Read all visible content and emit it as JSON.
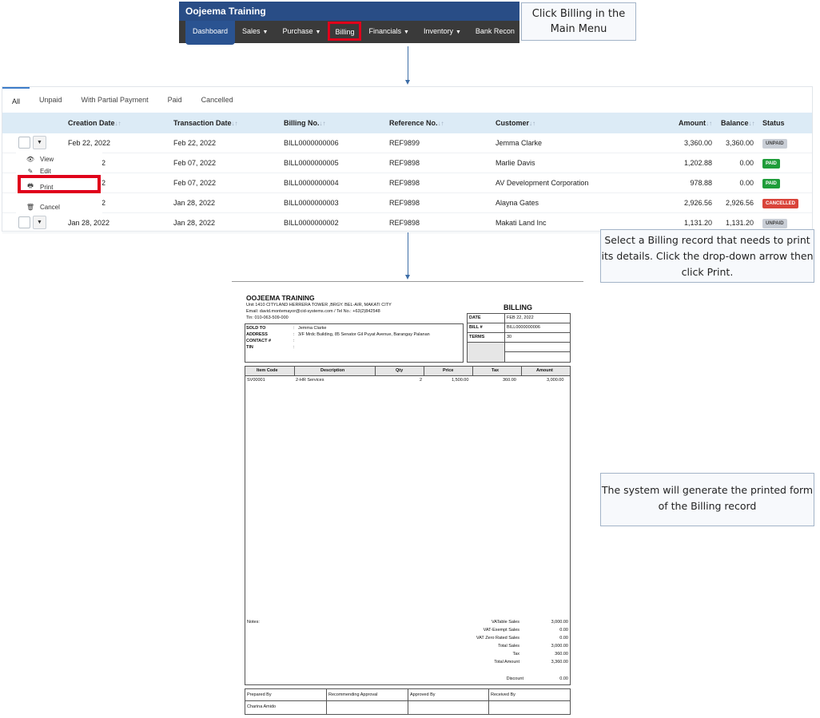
{
  "app": {
    "title": "Oojeema Training",
    "menu": [
      {
        "label": "Dashboard",
        "caret": false
      },
      {
        "label": "Sales",
        "caret": true
      },
      {
        "label": "Purchase",
        "caret": true
      },
      {
        "label": "Billing",
        "caret": false
      },
      {
        "label": "Financials",
        "caret": true
      },
      {
        "label": "Inventory",
        "caret": true
      },
      {
        "label": "Bank Recon",
        "caret": false
      }
    ]
  },
  "callouts": {
    "step1": "Click Billing in the Main Menu",
    "step2": "Select a Billing record that needs to print its details. Click the drop-down arrow then click Print.",
    "step3": "The system will generate the printed form of the Billing record"
  },
  "tabs": [
    "All",
    "Unpaid",
    "With Partial Payment",
    "Paid",
    "Cancelled"
  ],
  "table": {
    "headers": {
      "creation_date": "Creation Date",
      "transaction_date": "Transaction Date",
      "billing_no": "Billing No.",
      "reference_no": "Reference No.",
      "customer": "Customer",
      "amount": "Amount",
      "balance": "Balance",
      "status": "Status"
    },
    "rows": [
      {
        "creation": "Feb 22, 2022",
        "transaction": "Feb 22, 2022",
        "billing": "BILL0000000006",
        "reference": "REF9899",
        "customer": "Jemma Clarke",
        "amount": "3,360.00",
        "balance": "3,360.00",
        "status": "UNPAID",
        "status_color": "#c9ced6",
        "status_text": "#444444"
      },
      {
        "creation": "2",
        "transaction": "Feb 07, 2022",
        "billing": "BILL0000000005",
        "reference": "REF9898",
        "customer": "Marlie Davis",
        "amount": "1,202.88",
        "balance": "0.00",
        "status": "PAID",
        "status_color": "#1f9d3a",
        "status_text": "#ffffff"
      },
      {
        "creation": "2",
        "transaction": "Feb 07, 2022",
        "billing": "BILL0000000004",
        "reference": "REF9898",
        "customer": "AV Development Corporation",
        "amount": "978.88",
        "balance": "0.00",
        "status": "PAID",
        "status_color": "#1f9d3a",
        "status_text": "#ffffff"
      },
      {
        "creation": "2",
        "transaction": "Jan 28, 2022",
        "billing": "BILL0000000003",
        "reference": "REF9898",
        "customer": "Alayna Gates",
        "amount": "2,926.56",
        "balance": "2,926.56",
        "status": "CANCELLED",
        "status_color": "#d9443a",
        "status_text": "#ffffff"
      },
      {
        "creation": "Jan 28, 2022",
        "transaction": "Jan 28, 2022",
        "billing": "BILL0000000002",
        "reference": "REF9898",
        "customer": "Makati Land Inc",
        "amount": "1,131.20",
        "balance": "1,131.20",
        "status": "UNPAID",
        "status_color": "#c9ced6",
        "status_text": "#444444"
      }
    ]
  },
  "dropdown": {
    "view": "View",
    "edit": "Edit",
    "print": "Print",
    "cancel": "Cancel"
  },
  "form": {
    "company": "OOJEEMA TRAINING",
    "address": "Unit 1410 CITYLAND HERRERA TOWER ,BRGY. BEL-AIR, MAKATI CITY",
    "contact": "Email: david.montemayor@cid-systems.com / Tel No.: +63(2)842548",
    "tin": "Tin: 010-063-509-000",
    "doc_title": "BILLING",
    "sold_to_label": "SOLD TO",
    "sold_to": "Jemma Clarke",
    "address_label": "ADDRESS",
    "customer_address": "3/F Mrdc Building, 85 Senator Gil Puyat Avenue, Barangay Palanan",
    "contact_label": "CONTACT #",
    "tin_label": "TIN",
    "colon": ":",
    "date_label": "DATE",
    "date": "FEB 22, 2022",
    "bill_label": "BILL #",
    "bill_no": "BILL0000000006",
    "terms_label": "TERMS",
    "terms": "30",
    "items_headers": [
      "Item Code",
      "Description",
      "Qty",
      "Price",
      "Tax",
      "Amount"
    ],
    "items": [
      {
        "code": "SV00001",
        "description": "2-HR Services",
        "qty": "2",
        "price": "1,500.00",
        "tax": "360.00",
        "amount": "3,000.00"
      }
    ],
    "notes_label": "Notes:",
    "totals": [
      {
        "label": "VATable Sales",
        "value": "3,000.00"
      },
      {
        "label": "VAT-Exempt Sales",
        "value": "0.00"
      },
      {
        "label": "VAT Zero Rated Sales",
        "value": "0.00"
      },
      {
        "label": "Total Sales",
        "value": "3,000.00"
      },
      {
        "label": "Tax",
        "value": "360.00"
      },
      {
        "label": "Total Amount",
        "value": "3,360.00"
      }
    ],
    "discount_label": "Discount",
    "discount": "0.00",
    "signatures": [
      "Prepared By",
      "Recommending Approval",
      "Approved By",
      "Received By"
    ],
    "prepared_by_name": "Charina  Amido"
  }
}
